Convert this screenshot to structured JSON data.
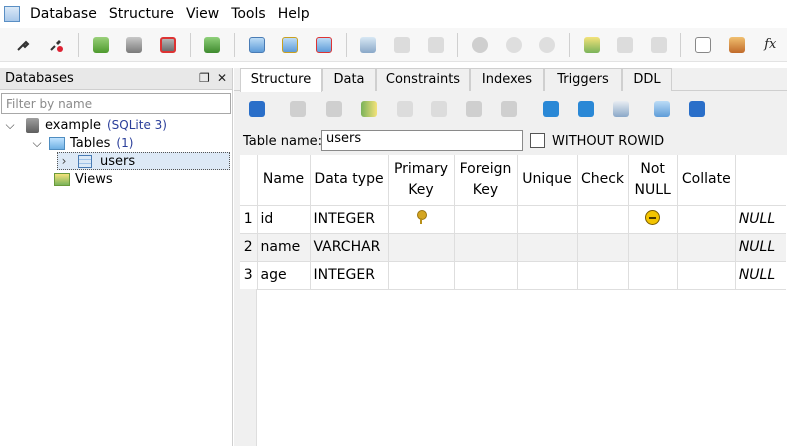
{
  "menubar": {
    "items": [
      "Database",
      "Structure",
      "View",
      "Tools",
      "Help"
    ]
  },
  "toolbar": {
    "formula_label": "fx"
  },
  "left_panel": {
    "title": "Databases",
    "filter_placeholder": "Filter by name",
    "tree": {
      "database": {
        "name": "example",
        "type": "(SQLite 3)"
      },
      "tables": {
        "label": "Tables",
        "count": "(1)"
      },
      "table_item": "users",
      "views": "Views"
    }
  },
  "right_panel": {
    "tabs": [
      "Structure",
      "Data",
      "Constraints",
      "Indexes",
      "Triggers",
      "DDL"
    ],
    "active_tab": "Structure",
    "table_name_label": "Table name:",
    "table_name_value": "users",
    "without_rowid_label": "WITHOUT ROWID",
    "without_rowid_checked": false,
    "columns": [
      "Name",
      "Data type",
      "Primary Key",
      "Foreign Key",
      "Unique",
      "Check",
      "Not NULL",
      "Collate",
      ""
    ],
    "rows": [
      {
        "num": "1",
        "name": "id",
        "type": "INTEGER",
        "primary_key": true,
        "not_null": true,
        "default": "NULL"
      },
      {
        "num": "2",
        "name": "name",
        "type": "VARCHAR",
        "primary_key": false,
        "not_null": false,
        "default": "NULL"
      },
      {
        "num": "3",
        "name": "age",
        "type": "INTEGER",
        "primary_key": false,
        "not_null": false,
        "default": "NULL"
      }
    ]
  },
  "icons": {
    "toolbar": [
      "connect-icon",
      "disconnect-icon",
      "add-database-icon",
      "edit-database-icon",
      "remove-database-icon",
      "refresh-database-icon",
      "add-table-icon",
      "edit-table-icon",
      "delete-table-icon",
      "add-index-icon",
      "edit-index-icon",
      "delete-index-icon",
      "add-trigger-icon",
      "edit-trigger-icon",
      "delete-trigger-icon",
      "add-view-icon",
      "edit-view-icon",
      "delete-view-icon",
      "sql-editor-icon",
      "export-icon",
      "function-icon"
    ],
    "accent": "#2a6fc9"
  }
}
